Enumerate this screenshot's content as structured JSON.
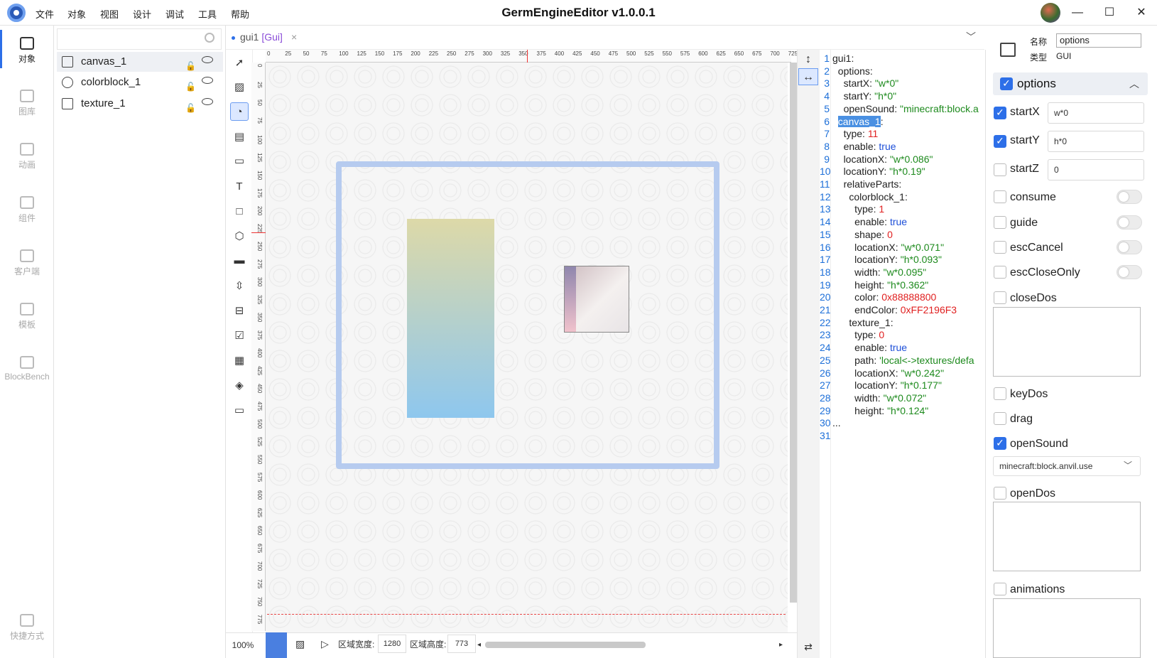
{
  "app": {
    "title": "GermEngineEditor v1.0.0.1"
  },
  "menu": [
    "文件",
    "对象",
    "视图",
    "设计",
    "调试",
    "工具",
    "帮助"
  ],
  "window_controls": {
    "minimize": "—",
    "maximize": "☐",
    "close": "✕"
  },
  "leftbar": [
    {
      "label": "对象",
      "icon": "layers-icon",
      "active": true
    },
    {
      "label": "图库",
      "icon": "gallery-icon",
      "active": false
    },
    {
      "label": "动画",
      "icon": "video-icon",
      "active": false
    },
    {
      "label": "组件",
      "icon": "puzzle-icon",
      "active": false
    },
    {
      "label": "客户端",
      "icon": "client-icon",
      "active": false
    },
    {
      "label": "模板",
      "icon": "template-icon",
      "active": false
    },
    {
      "label": "BlockBench",
      "icon": "blockbench-icon",
      "active": false
    },
    {
      "label": "快捷方式",
      "icon": "keyboard-icon",
      "active": false
    }
  ],
  "objects": [
    {
      "name": "canvas_1",
      "icon": "canvas-icon",
      "selected": true
    },
    {
      "name": "colorblock_1",
      "icon": "palette-icon",
      "selected": false
    },
    {
      "name": "texture_1",
      "icon": "image-icon",
      "selected": false
    }
  ],
  "tab": {
    "name": "gui1",
    "type": "[Gui]",
    "close": "×"
  },
  "ruler": {
    "h": [
      "0",
      "25",
      "50",
      "75",
      "100",
      "125",
      "150",
      "175",
      "200",
      "225",
      "250",
      "275",
      "300",
      "325",
      "350",
      "375",
      "400",
      "425",
      "450",
      "475",
      "500",
      "525",
      "550",
      "575",
      "600",
      "625",
      "650",
      "675",
      "700",
      "725"
    ],
    "v": [
      "0",
      "25",
      "50",
      "75",
      "100",
      "125",
      "150",
      "175",
      "200",
      "225",
      "250",
      "275",
      "300",
      "325",
      "350",
      "375",
      "400",
      "425",
      "450",
      "475",
      "500",
      "525",
      "550",
      "575",
      "600",
      "625",
      "650",
      "675",
      "700",
      "725",
      "750",
      "775"
    ]
  },
  "bottom": {
    "zoom": "100%",
    "width_label": "区域宽度:",
    "width_value": "1280",
    "height_label": "区域高度:",
    "height_value": "773"
  },
  "code": {
    "line_numbers": [
      "1",
      "2",
      "3",
      "4",
      "5",
      "6",
      "7",
      "8",
      "9",
      "10",
      "11",
      "12",
      "13",
      "14",
      "15",
      "16",
      "17",
      "18",
      "19",
      "20",
      "21",
      "22",
      "23",
      "24",
      "25",
      "26",
      "27",
      "28",
      "29",
      "30",
      "31"
    ],
    "lines": [
      {
        "i": "",
        "k": "gui1:",
        "v": "",
        "t": ""
      },
      {
        "i": "  ",
        "k": "options:",
        "v": "",
        "t": ""
      },
      {
        "i": "    ",
        "k": "startX: ",
        "v": "\"w*0\"",
        "t": "s"
      },
      {
        "i": "    ",
        "k": "startY: ",
        "v": "\"h*0\"",
        "t": "s"
      },
      {
        "i": "    ",
        "k": "openSound: ",
        "v": "\"minecraft:block.a",
        "t": "s"
      },
      {
        "i": "  ",
        "k": "canvas_1",
        "v": ":",
        "t": "hl"
      },
      {
        "i": "    ",
        "k": "type: ",
        "v": "11",
        "t": "n"
      },
      {
        "i": "    ",
        "k": "enable: ",
        "v": "true",
        "t": "b"
      },
      {
        "i": "    ",
        "k": "locationX: ",
        "v": "\"w*0.086\"",
        "t": "s"
      },
      {
        "i": "    ",
        "k": "locationY: ",
        "v": "\"h*0.19\"",
        "t": "s"
      },
      {
        "i": "    ",
        "k": "relativeParts:",
        "v": "",
        "t": ""
      },
      {
        "i": "      ",
        "k": "colorblock_1:",
        "v": "",
        "t": ""
      },
      {
        "i": "        ",
        "k": "type: ",
        "v": "1",
        "t": "n"
      },
      {
        "i": "        ",
        "k": "enable: ",
        "v": "true",
        "t": "b"
      },
      {
        "i": "        ",
        "k": "shape: ",
        "v": "0",
        "t": "n"
      },
      {
        "i": "        ",
        "k": "locationX: ",
        "v": "\"w*0.071\"",
        "t": "s"
      },
      {
        "i": "        ",
        "k": "locationY: ",
        "v": "\"h*0.093\"",
        "t": "s"
      },
      {
        "i": "        ",
        "k": "width: ",
        "v": "\"w*0.095\"",
        "t": "s"
      },
      {
        "i": "        ",
        "k": "height: ",
        "v": "\"h*0.362\"",
        "t": "s"
      },
      {
        "i": "        ",
        "k": "color: ",
        "v": "0x88888800",
        "t": "n"
      },
      {
        "i": "        ",
        "k": "endColor: ",
        "v": "0xFF2196F3",
        "t": "n"
      },
      {
        "i": "      ",
        "k": "texture_1:",
        "v": "",
        "t": ""
      },
      {
        "i": "        ",
        "k": "type: ",
        "v": "0",
        "t": "n"
      },
      {
        "i": "        ",
        "k": "enable: ",
        "v": "true",
        "t": "b"
      },
      {
        "i": "        ",
        "k": "path: ",
        "v": "'local<->textures/defa",
        "t": "s"
      },
      {
        "i": "        ",
        "k": "locationX: ",
        "v": "\"w*0.242\"",
        "t": "s"
      },
      {
        "i": "        ",
        "k": "locationY: ",
        "v": "\"h*0.177\"",
        "t": "s"
      },
      {
        "i": "        ",
        "k": "width: ",
        "v": "\"w*0.072\"",
        "t": "s"
      },
      {
        "i": "        ",
        "k": "height: ",
        "v": "\"h*0.124\"",
        "t": "s"
      },
      {
        "i": "",
        "k": "...",
        "v": "",
        "t": ""
      },
      {
        "i": "",
        "k": "",
        "v": "",
        "t": ""
      }
    ]
  },
  "props": {
    "name_label": "名称",
    "name_value": "options",
    "type_label": "类型",
    "type_value": "GUI",
    "section": "options",
    "fields": [
      {
        "label": "startX",
        "checked": true,
        "value": "w*0"
      },
      {
        "label": "startY",
        "checked": true,
        "value": "h*0"
      },
      {
        "label": "startZ",
        "checked": false,
        "value": "0"
      }
    ],
    "toggles": [
      {
        "label": "consume",
        "checked": false
      },
      {
        "label": "guide",
        "checked": false
      },
      {
        "label": "escCancel",
        "checked": false
      },
      {
        "label": "escCloseOnly",
        "checked": false
      }
    ],
    "closeDos": "closeDos",
    "keyDos": "keyDos",
    "drag": "drag",
    "openSound": "openSound",
    "openSound_value": "minecraft:block.anvil.use",
    "openDos": "openDos",
    "animations": "animations"
  },
  "colors": {
    "accent": "#2d6fe8",
    "frame": "#b6cbef",
    "string": "#1d8a1d",
    "number": "#e02020",
    "keyword": "#1d4fd8"
  }
}
